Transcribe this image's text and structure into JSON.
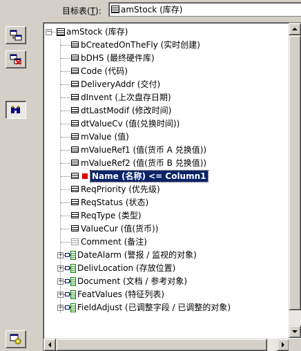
{
  "header": {
    "target_label_pre": "目标表(",
    "target_label_key": "T",
    "target_label_post": "):",
    "target_value": "amStock (库存)"
  },
  "toolbar": {
    "buttons": [
      {
        "name": "copy-table-button",
        "icon": "table-copy-icon"
      },
      {
        "name": "delete-table-button",
        "icon": "table-delete-icon"
      },
      {
        "name": "find-button",
        "icon": "binoculars-icon",
        "pressed": true
      },
      {
        "name": "table-settings-button",
        "icon": "table-gear-icon"
      }
    ]
  },
  "tree": {
    "root": {
      "label": "amStock (库存)",
      "expanded": true
    },
    "fields": [
      {
        "label": "bCreatedOnTheFly (实时创建)",
        "kind": "field"
      },
      {
        "label": "bDHS (最终硬件库)",
        "kind": "field"
      },
      {
        "label": "Code (代码)",
        "kind": "field"
      },
      {
        "label": "DeliveryAddr (交付)",
        "kind": "field"
      },
      {
        "label": "dInvent (上次盘存日期)",
        "kind": "field"
      },
      {
        "label": "dtLastModif (修改时间)",
        "kind": "field"
      },
      {
        "label": "dtValueCv (值(兑换时间))",
        "kind": "field"
      },
      {
        "label": "mValue (值)",
        "kind": "field"
      },
      {
        "label": "mValueRef1 (值(货币 A 兑换值))",
        "kind": "field"
      },
      {
        "label": "mValueRef2 (值(货币 B 兑换值))",
        "kind": "field"
      },
      {
        "label": "Name (名称)  <=  Column1",
        "kind": "key-mapped",
        "selected": true
      },
      {
        "label": "ReqPriority (优先级)",
        "kind": "field"
      },
      {
        "label": "ReqStatus (状态)",
        "kind": "field"
      },
      {
        "label": "ReqType (类型)",
        "kind": "field"
      },
      {
        "label": "ValueCur (值(货币))",
        "kind": "field"
      },
      {
        "label": "Comment (备注)",
        "kind": "comment"
      },
      {
        "label": "DateAlarm (警报 / 监视的对象)",
        "kind": "link"
      },
      {
        "label": "DelivLocation (存放位置)",
        "kind": "link"
      },
      {
        "label": "Document (文档 / 参考对象)",
        "kind": "link"
      },
      {
        "label": "FeatValues (特征列表)",
        "kind": "link"
      },
      {
        "label": "FieldAdjust (已调整字段 / 已调整的对象)",
        "kind": "link"
      }
    ]
  },
  "colors": {
    "selection": "#0a246a",
    "mapped_marker": "#e00000",
    "window_face": "#d4d0c8"
  }
}
